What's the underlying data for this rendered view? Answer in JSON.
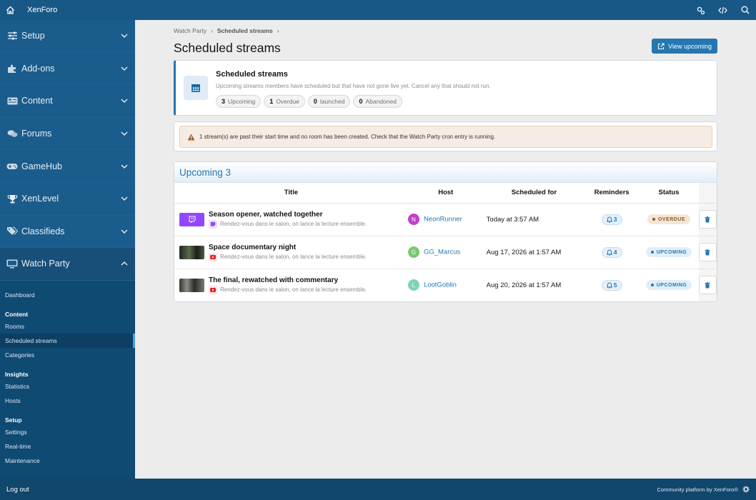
{
  "topbar": {
    "brand": "XenForo",
    "icons": [
      "home-icon",
      "settings-cog-icon",
      "code-icon",
      "search-icon"
    ]
  },
  "sidebar": {
    "sections": [
      {
        "label": "Setup",
        "icon": "sliders-icon"
      },
      {
        "label": "Add-ons",
        "icon": "puzzle-icon"
      },
      {
        "label": "Content",
        "icon": "content-icon"
      },
      {
        "label": "Forums",
        "icon": "comments-icon"
      },
      {
        "label": "GameHub",
        "icon": "gamepad-icon"
      },
      {
        "label": "XenLevel",
        "icon": "trophy-icon"
      },
      {
        "label": "Classifieds",
        "icon": "tags-icon"
      }
    ],
    "open_section": {
      "label": "Watch Party",
      "icon": "monitor-icon"
    },
    "sub": {
      "dashboard": "Dashboard",
      "content_header": "Content",
      "rooms": "Rooms",
      "scheduled": "Scheduled streams",
      "categories": "Categories",
      "insights_header": "Insights",
      "statistics": "Statistics",
      "hosts": "Hosts",
      "setup_header": "Setup",
      "settings": "Settings",
      "realtime": "Real-time",
      "maintenance": "Maintenance"
    }
  },
  "breadcrumb": {
    "item1": "Watch Party",
    "item2": "Scheduled streams"
  },
  "page": {
    "title": "Scheduled streams",
    "view_upcoming": "View upcoming"
  },
  "info": {
    "heading": "Scheduled streams",
    "description": "Upcoming streams members have scheduled but that have not gone live yet. Cancel any that should not run.",
    "pills": [
      {
        "count": "3",
        "label": "Upcoming"
      },
      {
        "count": "1",
        "label": "Overdue"
      },
      {
        "count": "0",
        "label": "launched"
      },
      {
        "count": "0",
        "label": "Abandoned"
      }
    ]
  },
  "warning": "1 stream(s) are past their start time and no room has been created. Check that the Watch Party cron entry is running.",
  "table": {
    "heading": "Upcoming 3",
    "columns": {
      "title": "Title",
      "host": "Host",
      "scheduled": "Scheduled for",
      "reminders": "Reminders",
      "status": "Status"
    },
    "rows": [
      {
        "title": "Season opener, watched together",
        "subtitle": "Rendez-vous dans le salon, on lance la lecture ensemble.",
        "source": "twitch",
        "host": "NeonRunner",
        "host_initial": "N",
        "host_color": "#c23fc9",
        "scheduled": "Today at 3:57 AM",
        "reminders": "3",
        "status": "OVERDUE"
      },
      {
        "title": "Space documentary night",
        "subtitle": "Rendez-vous dans le salon, on lance la lecture ensemble.",
        "source": "youtube",
        "host": "GG_Marcus",
        "host_initial": "G",
        "host_color": "#7bc96f",
        "scheduled": "Aug 17, 2026 at 1:57 AM",
        "reminders": "4",
        "status": "UPCOMING"
      },
      {
        "title": "The final, rewatched with commentary",
        "subtitle": "Rendez-vous dans le salon, on lance la lecture ensemble.",
        "source": "youtube",
        "host": "LootGoblin",
        "host_initial": "L",
        "host_color": "#7ed3b2",
        "scheduled": "Aug 20, 2026 at 1:57 AM",
        "reminders": "5",
        "status": "UPCOMING"
      }
    ]
  },
  "footer": {
    "logout": "Log out",
    "credit": "Community platform by XenForo®"
  },
  "colors": {
    "brand": "#185886",
    "accent": "#2577b1",
    "overdue": "#8a5a2a",
    "danger": "#d93a3a"
  }
}
